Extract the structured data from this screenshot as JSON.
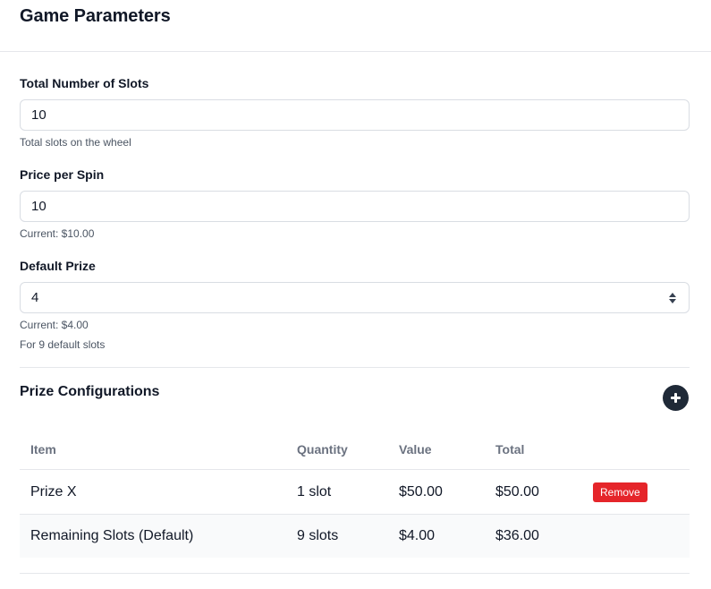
{
  "page": {
    "title": "Game Parameters"
  },
  "fields": {
    "total_slots": {
      "label": "Total Number of Slots",
      "value": "10",
      "hint": "Total slots on the wheel"
    },
    "price_per_spin": {
      "label": "Price per Spin",
      "value": "10",
      "hint": "Current: $10.00"
    },
    "default_prize": {
      "label": "Default Prize",
      "value": "4",
      "hint": "Current: $4.00",
      "hint2": "For 9 default slots"
    }
  },
  "prizes": {
    "title": "Prize Configurations",
    "add_icon": "plus-icon",
    "columns": [
      "Item",
      "Quantity",
      "Value",
      "Total"
    ],
    "rows": [
      {
        "item": "Prize X",
        "quantity": "1 slot",
        "value": "$50.00",
        "total": "$50.00",
        "action": "Remove"
      },
      {
        "item": "Remaining Slots (Default)",
        "quantity": "9 slots",
        "value": "$4.00",
        "total": "$36.00"
      }
    ]
  },
  "colors": {
    "accent": "#1f2937",
    "danger": "#e5252a",
    "muted": "#6b7280"
  }
}
